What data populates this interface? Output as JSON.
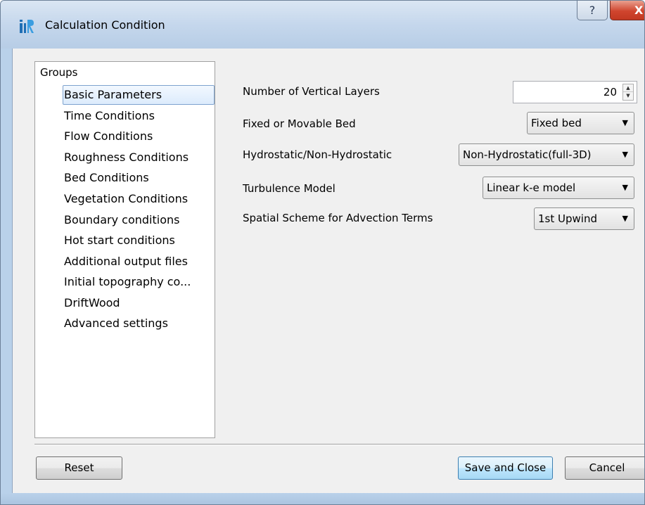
{
  "window": {
    "title": "Calculation Condition",
    "help_label": "?",
    "close_label": "X"
  },
  "groups": {
    "header": "Groups",
    "items": [
      {
        "label": "Basic Parameters",
        "selected": true
      },
      {
        "label": "Time Conditions"
      },
      {
        "label": "Flow Conditions"
      },
      {
        "label": "Roughness Conditions"
      },
      {
        "label": "Bed Conditions"
      },
      {
        "label": "Vegetation Conditions"
      },
      {
        "label": "Boundary conditions"
      },
      {
        "label": "Hot start conditions"
      },
      {
        "label": "Additional output files"
      },
      {
        "label": "Initial topography co..."
      },
      {
        "label": "DriftWood"
      },
      {
        "label": "Advanced settings"
      }
    ]
  },
  "params": {
    "vertical_layers": {
      "label": "Number of Vertical Layers",
      "value": "20"
    },
    "bed": {
      "label": "Fixed or Movable Bed",
      "value": "Fixed bed"
    },
    "hydrostatic": {
      "label": "Hydrostatic/Non-Hydrostatic",
      "value": "Non-Hydrostatic(full-3D)"
    },
    "turbulence": {
      "label": "Turbulence Model",
      "value": "Linear k-e model"
    },
    "spatial_scheme": {
      "label": "Spatial Scheme for Advection Terms",
      "value": "1st Upwind"
    }
  },
  "buttons": {
    "reset": "Reset",
    "save_close": "Save and Close",
    "cancel": "Cancel"
  },
  "icons": {
    "app": "iric-app-icon",
    "spin_up": "spin-up-icon",
    "spin_down": "spin-down-icon",
    "dropdown": "dropdown-arrow-icon"
  },
  "colors": {
    "title_bar": "#c5d7ec",
    "client_bg": "#f0f0f0",
    "selection": "#dcebfc",
    "default_button": "#bee6fd",
    "close_button": "#d0452e"
  }
}
